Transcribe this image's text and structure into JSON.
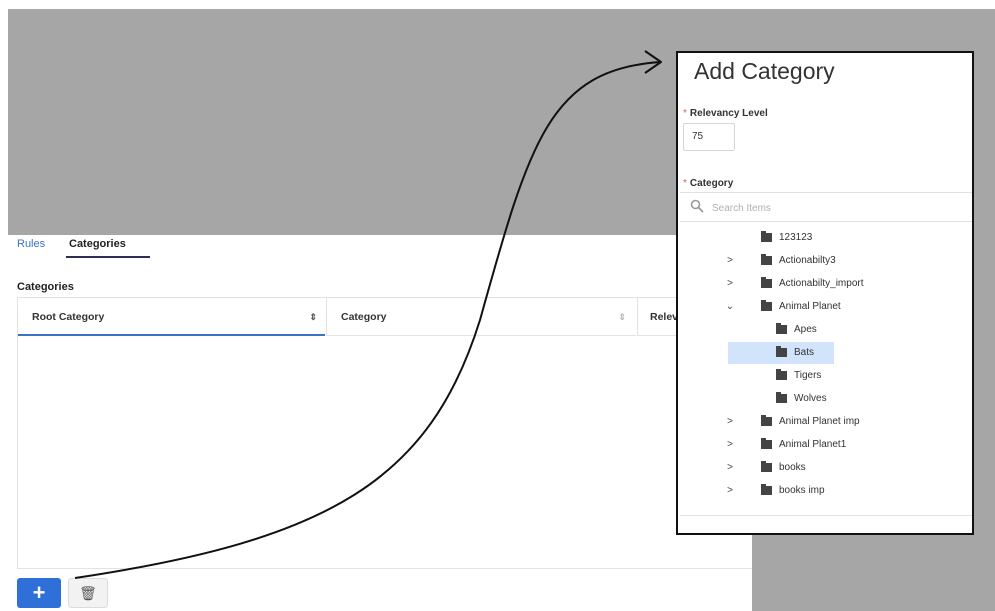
{
  "tabs": {
    "rules": "Rules",
    "categories": "Categories"
  },
  "section_title": "Categories",
  "table": {
    "columns": [
      "Root Category",
      "Category",
      "Relev"
    ],
    "sort_glyph": "⇕"
  },
  "toolbar": {
    "add_label": "+",
    "delete_label": "🗑"
  },
  "dialog": {
    "title": "Add Category",
    "required_mark": "*",
    "relevancy_label": "Relevancy Level",
    "relevancy_value": "75",
    "category_label": "Category",
    "search_placeholder": "Search Items",
    "tree": [
      {
        "label": "123123",
        "depth": 0,
        "expander": "",
        "selected": false
      },
      {
        "label": "Actionabilty3",
        "depth": 0,
        "expander": ">",
        "selected": false
      },
      {
        "label": "Actionabilty_import",
        "depth": 0,
        "expander": ">",
        "selected": false
      },
      {
        "label": "Animal Planet",
        "depth": 0,
        "expander": "⌄",
        "selected": false
      },
      {
        "label": "Apes",
        "depth": 1,
        "expander": "",
        "selected": false
      },
      {
        "label": "Bats",
        "depth": 1,
        "expander": "",
        "selected": true
      },
      {
        "label": "Tigers",
        "depth": 1,
        "expander": "",
        "selected": false
      },
      {
        "label": "Wolves",
        "depth": 1,
        "expander": "",
        "selected": false
      },
      {
        "label": "Animal Planet imp",
        "depth": 0,
        "expander": ">",
        "selected": false
      },
      {
        "label": "Animal Planet1",
        "depth": 0,
        "expander": ">",
        "selected": false
      },
      {
        "label": "books",
        "depth": 0,
        "expander": ">",
        "selected": false
      },
      {
        "label": "books imp",
        "depth": 0,
        "expander": ">",
        "selected": false
      }
    ]
  },
  "colors": {
    "accent": "#2f6fd8",
    "selected_row": "#d2e4fb",
    "overlay_gray": "#a6a6a6",
    "required": "#e05a5a"
  },
  "icons": [
    "search-icon",
    "folder-icon",
    "chevron-right-icon",
    "chevron-down-icon",
    "plus-icon",
    "trash-icon",
    "sort-icon",
    "callout-arrow"
  ]
}
